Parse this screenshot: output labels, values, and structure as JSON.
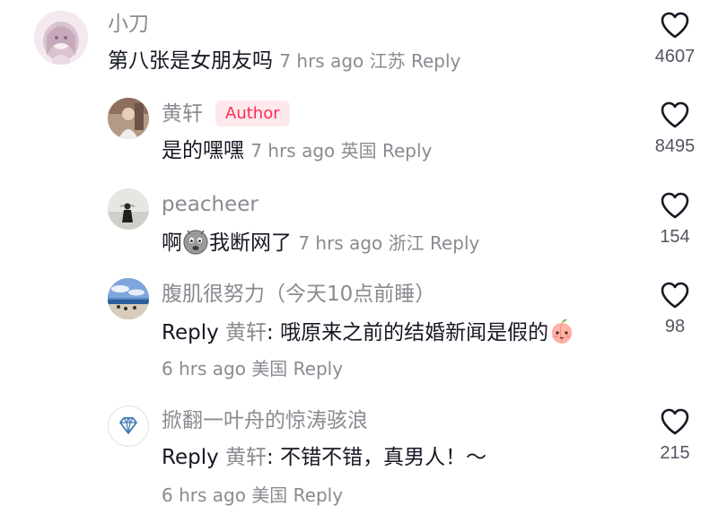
{
  "comments": [
    {
      "username": "小刀",
      "text": "第八张是女朋友吗",
      "time": "7 hrs ago",
      "location": "江苏",
      "reply_label": "Reply",
      "likes": "4607"
    },
    {
      "username": "黄轩",
      "badge": "Author",
      "text": "是的嘿嘿",
      "time": "7 hrs ago",
      "location": "英国",
      "reply_label": "Reply",
      "likes": "8495"
    },
    {
      "username": "peacheer",
      "text_before": "啊",
      "emoji": "crying-face-emoji",
      "text_after": "我断网了",
      "time": "7 hrs ago",
      "location": "浙江",
      "reply_label": "Reply",
      "likes": "154"
    },
    {
      "username": "腹肌很努力（今天10点前睡）",
      "reply_prefix": "Reply",
      "reply_to": "黄轩",
      "text": ": 哦原来之前的结婚新闻是假的",
      "emoji": "peach-shy-emoji",
      "time": "6 hrs ago",
      "location": "美国",
      "reply_label": "Reply",
      "likes": "98"
    },
    {
      "username": "掀翻一叶舟的惊涛骇浪",
      "reply_prefix": "Reply",
      "reply_to": "黄轩",
      "text": ": 不错不错，真男人！～",
      "time": "6 hrs ago",
      "location": "美国",
      "reply_label": "Reply",
      "likes": "215"
    }
  ],
  "colors": {
    "text": "#161823",
    "secondary": "#8a8b91",
    "author_badge_text": "#fe2c55",
    "author_badge_bg": "#fde8ec"
  },
  "icons": [
    "heart-outline-icon",
    "diamond-icon"
  ]
}
